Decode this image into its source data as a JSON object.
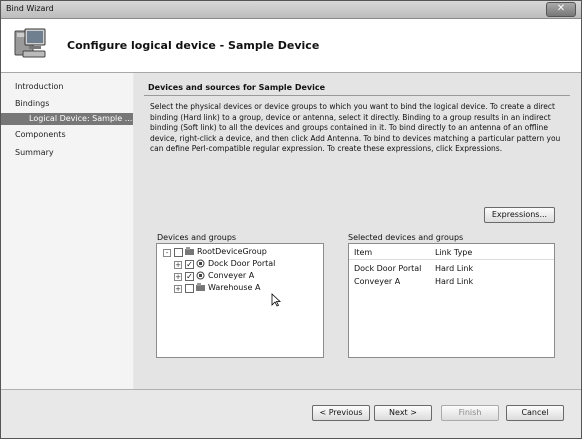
{
  "window": {
    "title": "Bind Wizard"
  },
  "header": {
    "title": "Configure logical device - Sample Device",
    "icon": "computer-icon"
  },
  "nav": {
    "items": [
      {
        "label": "Introduction"
      },
      {
        "label": "Bindings"
      },
      {
        "label": "Logical Device: Sample ..."
      },
      {
        "label": "Components"
      },
      {
        "label": "Summary"
      }
    ]
  },
  "content": {
    "section_title": "Devices and sources for Sample Device",
    "description": "Select the physical devices or device groups to which you want to bind the logical device. To create a direct binding (Hard link) to a group, device or antenna, select it directly. Binding to a group results in an indirect binding (Soft link) to all the devices and groups contained in it. To bind directly to an antenna of an offline device, right-click a device, and then click Add Antenna. To bind to devices matching a particular pattern you can define Perl-compatible regular expression. To create these expressions, click Expressions.",
    "expressions_button": "Expressions...",
    "devices_label": "Devices and groups",
    "selected_label": "Selected devices and groups",
    "tree": {
      "root": {
        "label": "RootDeviceGroup",
        "expander": "-",
        "checked": false
      },
      "children": [
        {
          "label": "Dock Door Portal",
          "expander": "+",
          "checked": true
        },
        {
          "label": "Conveyer A",
          "expander": "+",
          "checked": true
        },
        {
          "label": "Warehouse A",
          "expander": "+",
          "checked": false
        }
      ]
    },
    "selected_grid": {
      "columns": [
        "Item",
        "Link Type"
      ],
      "rows": [
        [
          "Dock Door Portal",
          "Hard Link"
        ],
        [
          "Conveyer A",
          "Hard Link"
        ]
      ]
    }
  },
  "footer": {
    "previous": "< Previous",
    "next": "Next >",
    "finish": "Finish",
    "cancel": "Cancel"
  }
}
